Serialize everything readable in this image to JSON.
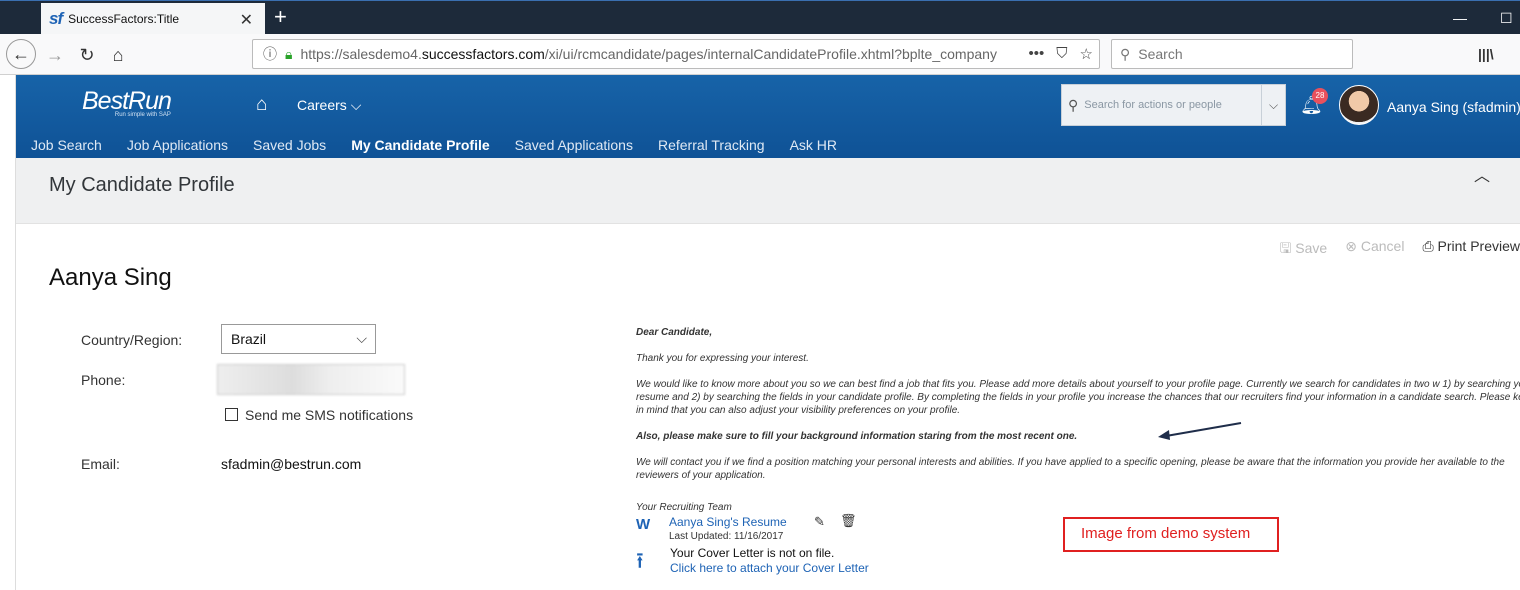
{
  "browser": {
    "tab_title": "SuccessFactors:Title",
    "tab_logo": "sf",
    "url_prefix": "https://salesdemo4.",
    "url_domain": "successfactors.com",
    "url_path": "/xi/ui/rcmcandidate/pages/internalCandidateProfile.xhtml?bplte_company",
    "search_placeholder": "Search",
    "more_label": "•••"
  },
  "header": {
    "logo": "BestRun",
    "logo_tagline": "Run simple with SAP",
    "careers_label": "Careers",
    "search_placeholder": "Search for actions or people",
    "notification_count": "28",
    "user_name": "Aanya Sing (sfadmin)"
  },
  "subnav": {
    "items": [
      "Job Search",
      "Job Applications",
      "Saved Jobs",
      "My Candidate Profile",
      "Saved Applications",
      "Referral Tracking",
      "Ask HR"
    ],
    "active_index": 3
  },
  "page": {
    "title": "My Candidate Profile",
    "save_label": "Save",
    "cancel_label": "Cancel",
    "print_label": "Print Preview"
  },
  "profile": {
    "name": "Aanya Sing",
    "country_label": "Country/Region:",
    "country_value": "Brazil",
    "phone_label": "Phone:",
    "sms_label": "Send me SMS notifications",
    "email_label": "Email:",
    "email_value": "sfadmin@bestrun.com"
  },
  "message": {
    "greeting": "Dear Candidate,",
    "p1": "Thank you for expressing your interest.",
    "p2": "We would like to know more about you so we can best find a job that fits you. Please add more details about yourself to your profile page. Currently we search for candidates in two w 1) by searching your resume and 2) by searching the fields in your candidate profile. By completing the fields in your profile you increase the chances that our recruiters find your information in a candidate search. Please keep in mind that you can also adjust your visibility preferences on your profile.",
    "p3": "Also, please make sure to fill your background information staring from the most recent one.",
    "p4": "We will contact you if we find a position matching your personal interests and abilities. If you have applied to a specific opening, please be aware that the information you provide her available to the reviewers of your application.",
    "signature": "Your Recruiting Team"
  },
  "attachments": {
    "resume_link": "Aanya Sing's Resume",
    "resume_updated": "Last Updated: 11/16/2017",
    "cover_status": "Your Cover Letter is not on file.",
    "cover_link": "Click here to attach your Cover Letter"
  },
  "annotation": {
    "text": "Image from demo system",
    "color": "#e02020"
  },
  "colors": {
    "brand_blue": "#1763a8",
    "link_blue": "#1e63b5"
  }
}
